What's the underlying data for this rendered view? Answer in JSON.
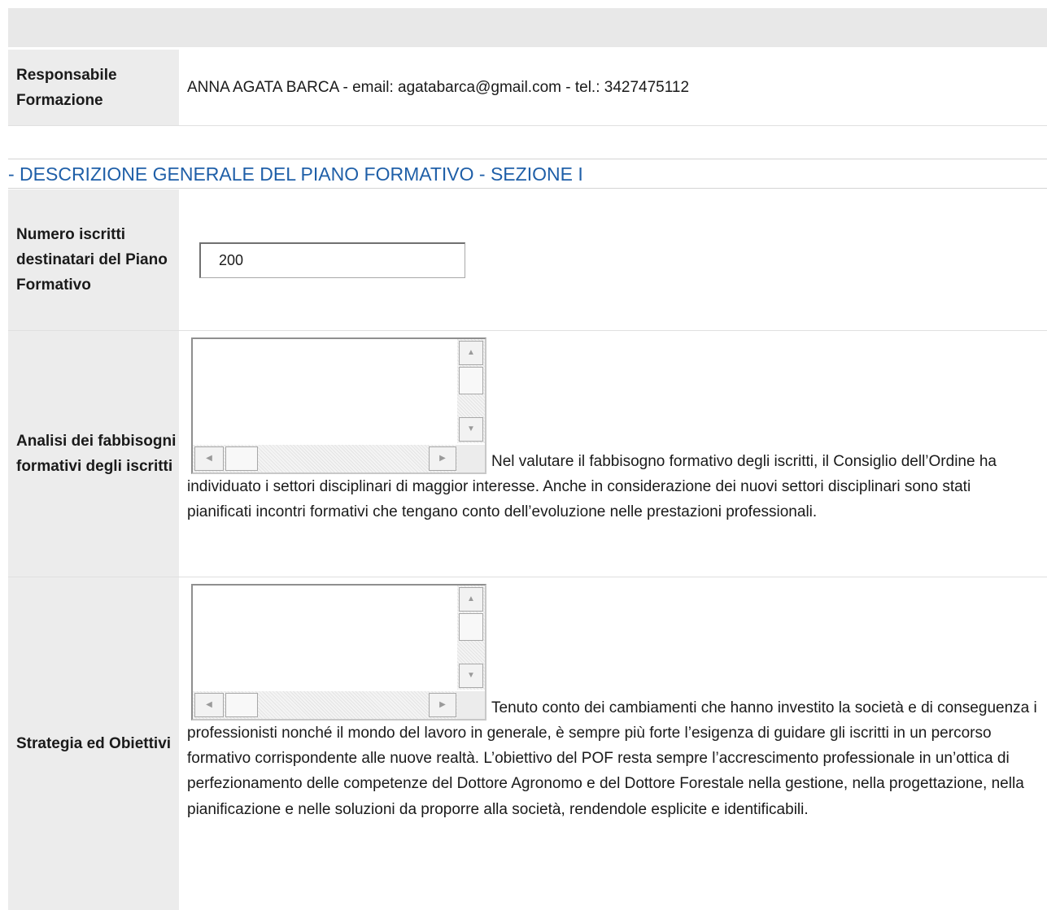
{
  "responsabile": {
    "label": "Responsabile Formazione",
    "value": "ANNA AGATA BARCA - email: agatabarca@gmail.com - tel.: 3427475112"
  },
  "section": {
    "title": "- DESCRIZIONE GENERALE DEL PIANO FORMATIVO - SEZIONE I"
  },
  "numero_iscritti": {
    "label": "Numero iscritti destinatari del Piano Formativo",
    "value": "200"
  },
  "analisi": {
    "label": "Analisi dei fabbisogni formativi degli iscritti",
    "text": "Nel valutare il fabbisogno formativo degli iscritti, il Consiglio dell’Ordine ha individuato i settori disciplinari di maggior interesse. Anche in considerazione dei nuovi settori disciplinari sono stati pianificati incontri formativi che tengano conto dell’evoluzione nelle prestazioni professionali."
  },
  "strategia": {
    "label": "Strategia ed Obiettivi",
    "text": "Tenuto conto dei cambiamenti che hanno investito la società e di conseguenza i professionisti nonché il mondo del lavoro in generale, è sempre più forte l’esigenza di guidare gli iscritti in un percorso formativo corrispondente alle nuove realtà. L’obiettivo del POF resta sempre l’accrescimento professionale in un’ottica di perfezionamento delle competenze del Dottore Agronomo e del Dottore Forestale nella gestione, nella progettazione, nella pianificazione e nelle soluzioni da proporre alla società, rendendole esplicite e identificabili."
  },
  "icons": {
    "up": "scroll-up-arrow",
    "down": "scroll-down-arrow",
    "left": "scroll-left-arrow",
    "right": "scroll-right-arrow"
  },
  "colors": {
    "section_title": "#1f5fa8",
    "label_bg": "#ececec",
    "top_band": "#e8e8e8"
  }
}
